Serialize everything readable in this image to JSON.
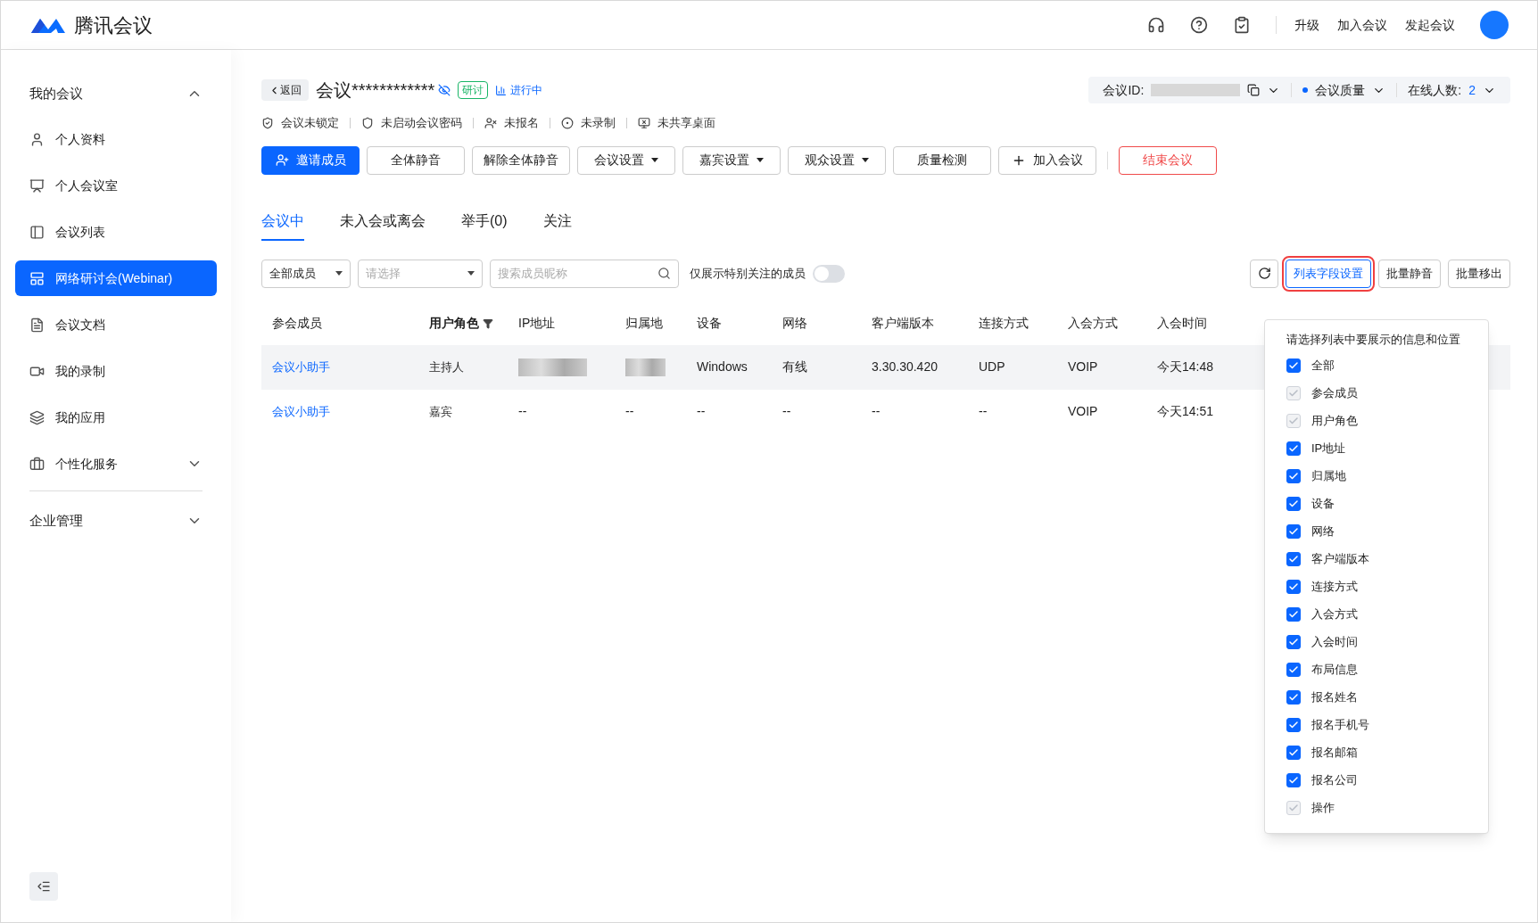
{
  "header": {
    "brand": "腾讯会议",
    "links": [
      "升级",
      "加入会议",
      "发起会议"
    ]
  },
  "sidebar": {
    "sections": [
      {
        "title": "我的会议",
        "expanded": true,
        "items": [
          {
            "label": "个人资料",
            "selected": false
          },
          {
            "label": "个人会议室",
            "selected": false
          },
          {
            "label": "会议列表",
            "selected": false
          },
          {
            "label": "网络研讨会(Webinar)",
            "selected": true
          },
          {
            "label": "会议文档",
            "selected": false
          },
          {
            "label": "我的录制",
            "selected": false
          },
          {
            "label": "我的应用",
            "selected": false
          },
          {
            "label": "个性化服务",
            "selected": false,
            "expandable": true
          }
        ]
      },
      {
        "title": "企业管理",
        "expanded": false
      }
    ]
  },
  "meeting": {
    "back": "返回",
    "title": "会议************",
    "tag": "研讨",
    "status": "进行中",
    "id_label": "会议ID:",
    "quality": "会议质量",
    "online_label": "在线人数:",
    "online_count": "2",
    "flags": [
      "会议未锁定",
      "未启动会议密码",
      "未报名",
      "未录制",
      "未共享桌面"
    ]
  },
  "actions": [
    {
      "label": "邀请成员",
      "kind": "primary"
    },
    {
      "label": "全体静音",
      "kind": "plain"
    },
    {
      "label": "解除全体静音",
      "kind": "plain"
    },
    {
      "label": "会议设置",
      "kind": "dropdown"
    },
    {
      "label": "嘉宾设置",
      "kind": "dropdown"
    },
    {
      "label": "观众设置",
      "kind": "dropdown"
    },
    {
      "label": "质量检测",
      "kind": "plain"
    },
    {
      "label": "加入会议",
      "kind": "add"
    },
    {
      "label": "结束会议",
      "kind": "danger"
    }
  ],
  "tabs": [
    {
      "label": "会议中",
      "selected": true
    },
    {
      "label": "未入会或离会",
      "selected": false
    },
    {
      "label": "举手(0)",
      "selected": false
    },
    {
      "label": "关注",
      "selected": false
    }
  ],
  "filters": {
    "member_select": "全部成员",
    "role_placeholder": "请选择",
    "search_placeholder": "搜索成员昵称",
    "focus_only_label": "仅展示特别关注的成员",
    "focus_only_on": false
  },
  "list_buttons": [
    {
      "label": "列表字段设置",
      "selected": true
    },
    {
      "label": "批量静音",
      "selected": false
    },
    {
      "label": "批量移出",
      "selected": false
    }
  ],
  "table": {
    "columns": [
      "参会成员",
      "用户角色",
      "IP地址",
      "归属地",
      "设备",
      "网络",
      "客户端版本",
      "连接方式",
      "入会方式",
      "入会时间"
    ],
    "rows": [
      {
        "highlighted": true,
        "cells": [
          {
            "kind": "link",
            "text": "会议小助手"
          },
          {
            "kind": "text",
            "text": "主持人"
          },
          {
            "kind": "blurred"
          },
          {
            "kind": "blurred"
          },
          {
            "kind": "text",
            "text": "Windows"
          },
          {
            "kind": "text",
            "text": "有线"
          },
          {
            "kind": "text",
            "text": "3.30.30.420"
          },
          {
            "kind": "text",
            "text": "UDP"
          },
          {
            "kind": "text",
            "text": "VOIP"
          },
          {
            "kind": "text",
            "text": "今天14:48"
          }
        ]
      },
      {
        "highlighted": false,
        "cells": [
          {
            "kind": "link",
            "text": "会议小助手"
          },
          {
            "kind": "text",
            "text": "嘉宾"
          },
          {
            "kind": "text",
            "text": "--"
          },
          {
            "kind": "text",
            "text": "--"
          },
          {
            "kind": "text",
            "text": "--"
          },
          {
            "kind": "text",
            "text": "--"
          },
          {
            "kind": "text",
            "text": "--"
          },
          {
            "kind": "text",
            "text": "--"
          },
          {
            "kind": "text",
            "text": "VOIP"
          },
          {
            "kind": "text",
            "text": "今天14:51"
          }
        ]
      }
    ]
  },
  "field_popup": {
    "title": "请选择列表中要展示的信息和位置",
    "options": [
      {
        "label": "全部",
        "checked": true,
        "disabled": false
      },
      {
        "label": "参会成员",
        "checked": true,
        "disabled": true
      },
      {
        "label": "用户角色",
        "checked": true,
        "disabled": true
      },
      {
        "label": "IP地址",
        "checked": true,
        "disabled": false
      },
      {
        "label": "归属地",
        "checked": true,
        "disabled": false
      },
      {
        "label": "设备",
        "checked": true,
        "disabled": false
      },
      {
        "label": "网络",
        "checked": true,
        "disabled": false
      },
      {
        "label": "客户端版本",
        "checked": true,
        "disabled": false
      },
      {
        "label": "连接方式",
        "checked": true,
        "disabled": false
      },
      {
        "label": "入会方式",
        "checked": true,
        "disabled": false
      },
      {
        "label": "入会时间",
        "checked": true,
        "disabled": false
      },
      {
        "label": "布局信息",
        "checked": true,
        "disabled": false
      },
      {
        "label": "报名姓名",
        "checked": true,
        "disabled": false
      },
      {
        "label": "报名手机号",
        "checked": true,
        "disabled": false
      },
      {
        "label": "报名邮箱",
        "checked": true,
        "disabled": false
      },
      {
        "label": "报名公司",
        "checked": true,
        "disabled": false
      },
      {
        "label": "操作",
        "checked": true,
        "disabled": true
      }
    ]
  }
}
